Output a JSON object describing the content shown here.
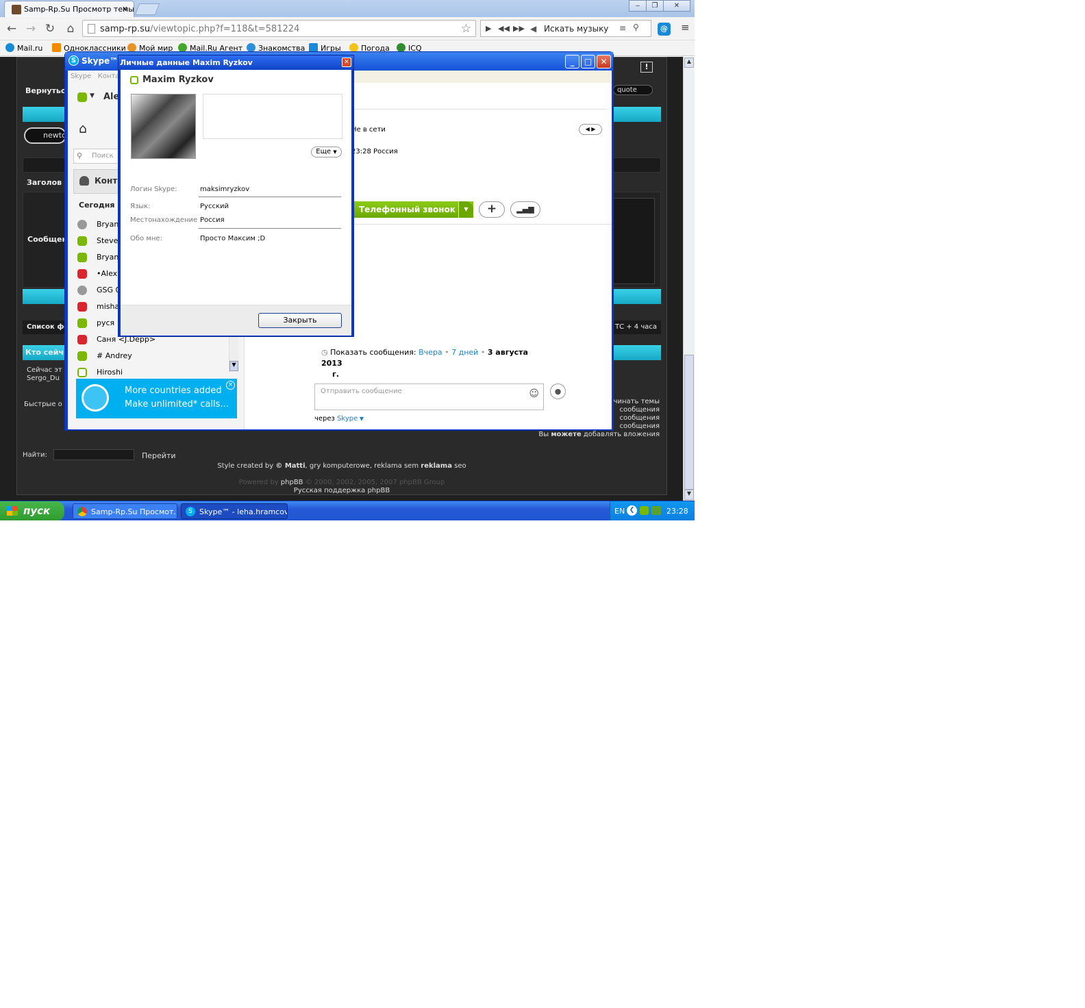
{
  "browser": {
    "tab_title": "Samp-Rp.Su Просмотр темы",
    "tab_close": "×",
    "url_host": "samp-rp.su",
    "url_path": "/viewtopic.php?f=118&t=581224",
    "music_placeholder": "Искать музыку",
    "bookmarks": [
      "Mail.ru",
      "Одноклассники",
      "Мой мир",
      "Mail.Ru Агент",
      "Знакомства",
      "Игры",
      "Погода",
      "ICQ"
    ]
  },
  "forum": {
    "back": "Вернуться",
    "newtopic": "newto",
    "quote": "quote",
    "subject_label": "Заголов",
    "message_label": "Сообщен",
    "forum_list": "Список фо",
    "tz": "ТС + 4 часа",
    "who_online": "Кто сейч",
    "now_here": "Сейчас эт",
    "user": "Sergo_Du",
    "quick": "Быстрые о",
    "perm1": "чинать темы",
    "perm2": "сообщения",
    "perm3": "сообщения",
    "perm4": "сообщения",
    "perm5_a": "Вы ",
    "perm5_b": "можете",
    "perm5_c": " добавлять вложения",
    "find": "Найти:",
    "go": "Перейти",
    "style_a": "Style created by ",
    "style_b": "© Matti",
    "style_c": ", gry komputerowe, reklama sem ",
    "style_d": "reklama",
    "style_e": " seo",
    "powered_a": "Powered by ",
    "powered_b": "phpBB",
    "powered_c": " © 2000, 2002, 2005, 2007 phpBB Group",
    "ru_support": "Русская поддержка phpBB"
  },
  "skype": {
    "title": "Skype™",
    "menu": [
      "Skype",
      "Конта"
    ],
    "user_short": "Ale",
    "search": "Поиск",
    "contacts_header": "Конта",
    "today": "Сегодня",
    "contacts": [
      {
        "name": "Bryan_",
        "status": "grp"
      },
      {
        "name": "Steve_",
        "status": "on"
      },
      {
        "name": "Bryan_",
        "status": "on"
      },
      {
        "name": "•Alex E",
        "status": "off"
      },
      {
        "name": "GSG 03",
        "status": "grp"
      },
      {
        "name": "misha_",
        "status": "off"
      },
      {
        "name": "руся",
        "status": "on"
      },
      {
        "name": "Саня <J.Depp>",
        "status": "off"
      },
      {
        "name": "# Andrey",
        "status": "on"
      },
      {
        "name": "Hiroshi",
        "status": "away"
      }
    ],
    "ad_line1": "More countries added",
    "ad_line2": "Make unlimited* calls...",
    "offline": "Не в сети",
    "local_time": "23:28 Россия",
    "call_button": "Телефонный звонок",
    "show_messages": "Показать сообщения:",
    "yesterday": "Вчера",
    "seven_days": "7 дней",
    "date": "3 августа 2013",
    "date_suffix": "г.",
    "message_placeholder": "Отправить сообщение",
    "via": "через",
    "via_skype": "Skype"
  },
  "dialog": {
    "title": "Личные данные Maxim Ryzkov",
    "name": "Maxim Ryzkov",
    "more": "Еще",
    "login_label": "Логин Skype:",
    "login": "maksimryzkov",
    "lang_label": "Язык:",
    "lang": "Русский",
    "location_label": "Местонахождение",
    "location": "Россия",
    "about_label": "Обо мне:",
    "about": "Просто Максим ;D",
    "close": "Закрыть"
  },
  "taskbar": {
    "start": "пуск",
    "task1": "Samp-Rp.Su Просмот...",
    "task2": "Skype™ - leha.hramcov",
    "lang": "EN",
    "clock": "23:28"
  },
  "colors": {
    "accent": "#00aff0",
    "skype_green": "#7ab800",
    "forum_cyan": "#16a8c4",
    "xp_blue": "#2157d4"
  }
}
